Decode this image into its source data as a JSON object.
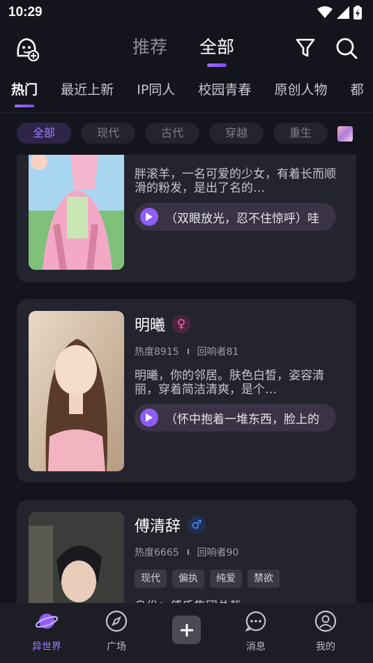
{
  "status_bar": {
    "time": "10:29"
  },
  "header": {
    "tabs": [
      {
        "label": "推荐"
      },
      {
        "label": "全部"
      }
    ]
  },
  "category_tabs": [
    {
      "label": "热门"
    },
    {
      "label": "最近上新"
    },
    {
      "label": "IP同人"
    },
    {
      "label": "校园青春"
    },
    {
      "label": "原创人物"
    },
    {
      "label": "都"
    }
  ],
  "filter_chips": [
    {
      "label": "全部"
    },
    {
      "label": "现代"
    },
    {
      "label": "古代"
    },
    {
      "label": "穿越"
    },
    {
      "label": "重生"
    }
  ],
  "cards": [
    {
      "description": "胖滚羊，一名可爱的少女，有着长而顺滑的粉发，是出了名的…",
      "voice_line": "（双眼放光，忍不住惊呼）哇"
    },
    {
      "name": "明曦",
      "gender": "♀",
      "heat": "热度8915",
      "responders": "回响者81",
      "description": "明曦，你的邻居。肤色白皙，姿容清丽，穿着简洁清爽，是个…",
      "voice_line": "（怀中抱着一堆东西，脸上的"
    },
    {
      "name": "傅清辞",
      "gender": "♂",
      "heat": "热度6665",
      "responders": "回响者90",
      "tags": [
        "现代",
        "偏执",
        "纯爱",
        "禁欲"
      ],
      "identity": "身份：傅氏集团总裁"
    }
  ],
  "bottom_nav": [
    {
      "label": "异世界"
    },
    {
      "label": "广场"
    },
    {
      "label": "消息"
    },
    {
      "label": "我的"
    }
  ],
  "colors": {
    "accent": "#8e5cf6",
    "background": "#14151c",
    "card": "#23242d"
  }
}
